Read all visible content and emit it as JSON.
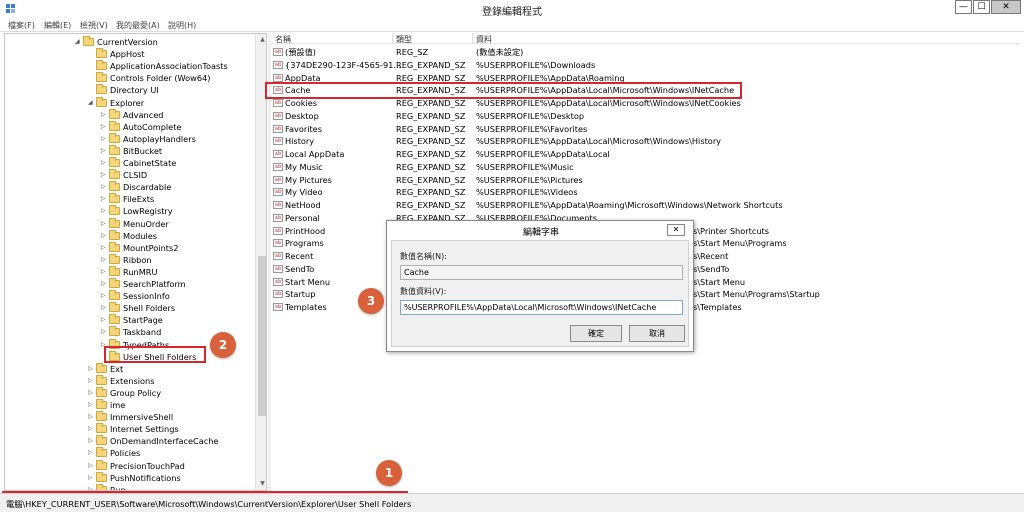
{
  "window": {
    "title": "登錄編輯程式",
    "min": "—",
    "max": "☐",
    "close": "✕"
  },
  "menu": [
    "檔案(F)",
    "編輯(E)",
    "檢視(V)",
    "我的最愛(A)",
    "說明(H)"
  ],
  "tree": {
    "items": [
      {
        "label": "CurrentVersion",
        "expanded": true
      },
      {
        "label": "AppHost",
        "expanded": false
      },
      {
        "label": "ApplicationAssociationToasts",
        "expanded": false
      },
      {
        "label": "Controls Folder (Wow64)",
        "expanded": false
      },
      {
        "label": "Directory UI",
        "expanded": false
      },
      {
        "label": "Explorer",
        "expanded": true
      },
      {
        "label": "Advanced",
        "expanded": false
      },
      {
        "label": "AutoComplete",
        "expanded": false
      },
      {
        "label": "AutoplayHandlers",
        "expanded": false
      },
      {
        "label": "BitBucket",
        "expanded": false
      },
      {
        "label": "CabinetState",
        "expanded": false
      },
      {
        "label": "CLSID",
        "expanded": false
      },
      {
        "label": "Discardable",
        "expanded": false
      },
      {
        "label": "FileExts",
        "expanded": false
      },
      {
        "label": "LowRegistry",
        "expanded": false
      },
      {
        "label": "MenuOrder",
        "expanded": false
      },
      {
        "label": "Modules",
        "expanded": false
      },
      {
        "label": "MountPoints2",
        "expanded": false
      },
      {
        "label": "Ribbon",
        "expanded": false
      },
      {
        "label": "RunMRU",
        "expanded": false
      },
      {
        "label": "SearchPlatform",
        "expanded": false
      },
      {
        "label": "SessionInfo",
        "expanded": false
      },
      {
        "label": "Shell Folders",
        "expanded": false
      },
      {
        "label": "StartPage",
        "expanded": false
      },
      {
        "label": "Taskband",
        "expanded": false
      },
      {
        "label": "TypedPaths",
        "expanded": false
      },
      {
        "label": "User Shell Folders",
        "expanded": false,
        "selected": true
      },
      {
        "label": "Ext",
        "expanded": false
      },
      {
        "label": "Extensions",
        "expanded": false
      },
      {
        "label": "Group Policy",
        "expanded": false
      },
      {
        "label": "ime",
        "expanded": false
      },
      {
        "label": "ImmersiveShell",
        "expanded": false
      },
      {
        "label": "Internet Settings",
        "expanded": false
      },
      {
        "label": "OnDemandInterfaceCache",
        "expanded": false
      },
      {
        "label": "Policies",
        "expanded": false
      },
      {
        "label": "PrecisionTouchPad",
        "expanded": false
      },
      {
        "label": "PushNotifications",
        "expanded": false
      },
      {
        "label": "Run",
        "expanded": false
      }
    ]
  },
  "list": {
    "headers": [
      "名稱",
      "類型",
      "資料"
    ],
    "rows": [
      {
        "name": "(預設值)",
        "type": "REG_SZ",
        "data": "(數值未設定)"
      },
      {
        "name": "{374DE290-123F-4565-91...",
        "type": "REG_EXPAND_SZ",
        "data": "%USERPROFILE%\\Downloads"
      },
      {
        "name": "AppData",
        "type": "REG_EXPAND_SZ",
        "data": "%USERPROFILE%\\AppData\\Roaming"
      },
      {
        "name": "Cache",
        "type": "REG_EXPAND_SZ",
        "data": "%USERPROFILE%\\AppData\\Local\\Microsoft\\Windows\\INetCache",
        "highlighted": true
      },
      {
        "name": "Cookies",
        "type": "REG_EXPAND_SZ",
        "data": "%USERPROFILE%\\AppData\\Local\\Microsoft\\Windows\\INetCookies"
      },
      {
        "name": "Desktop",
        "type": "REG_EXPAND_SZ",
        "data": "%USERPROFILE%\\Desktop"
      },
      {
        "name": "Favorites",
        "type": "REG_EXPAND_SZ",
        "data": "%USERPROFILE%\\Favorites"
      },
      {
        "name": "History",
        "type": "REG_EXPAND_SZ",
        "data": "%USERPROFILE%\\AppData\\Local\\Microsoft\\Windows\\History"
      },
      {
        "name": "Local AppData",
        "type": "REG_EXPAND_SZ",
        "data": "%USERPROFILE%\\AppData\\Local"
      },
      {
        "name": "My Music",
        "type": "REG_EXPAND_SZ",
        "data": "%USERPROFILE%\\Music"
      },
      {
        "name": "My Pictures",
        "type": "REG_EXPAND_SZ",
        "data": "%USERPROFILE%\\Pictures"
      },
      {
        "name": "My Video",
        "type": "REG_EXPAND_SZ",
        "data": "%USERPROFILE%\\Videos"
      },
      {
        "name": "NetHood",
        "type": "REG_EXPAND_SZ",
        "data": "%USERPROFILE%\\AppData\\Roaming\\Microsoft\\Windows\\Network Shortcuts"
      },
      {
        "name": "Personal",
        "type": "REG_EXPAND_SZ",
        "data": "%USERPROFILE%\\Documents"
      },
      {
        "name": "PrintHood",
        "type": "",
        "data": "s\\Printer Shortcuts"
      },
      {
        "name": "Programs",
        "type": "",
        "data": "s\\Start Menu\\Programs"
      },
      {
        "name": "Recent",
        "type": "",
        "data": "s\\Recent"
      },
      {
        "name": "SendTo",
        "type": "",
        "data": "s\\SendTo"
      },
      {
        "name": "Start Menu",
        "type": "",
        "data": "s\\Start Menu"
      },
      {
        "name": "Startup",
        "type": "",
        "data": "s\\Start Menu\\Programs\\Startup"
      },
      {
        "name": "Templates",
        "type": "",
        "data": "s\\Templates"
      }
    ]
  },
  "dialog": {
    "title": "編輯字串",
    "close": "✕",
    "name_label": "數值名稱(N):",
    "name_value": "Cache",
    "data_label": "數值資料(V):",
    "data_value": "%USERPROFILE%\\AppData\\Local\\Microsoft\\Windows\\INetCache",
    "ok": "確定",
    "cancel": "取消"
  },
  "status": {
    "path": "電腦\\HKEY_CURRENT_USER\\Software\\Microsoft\\Windows\\CurrentVersion\\Explorer\\User Shell Folders"
  },
  "annotations": {
    "badges": [
      "1",
      "2",
      "3"
    ],
    "color": "#d8603a",
    "highlight_color": "#d9262c"
  }
}
